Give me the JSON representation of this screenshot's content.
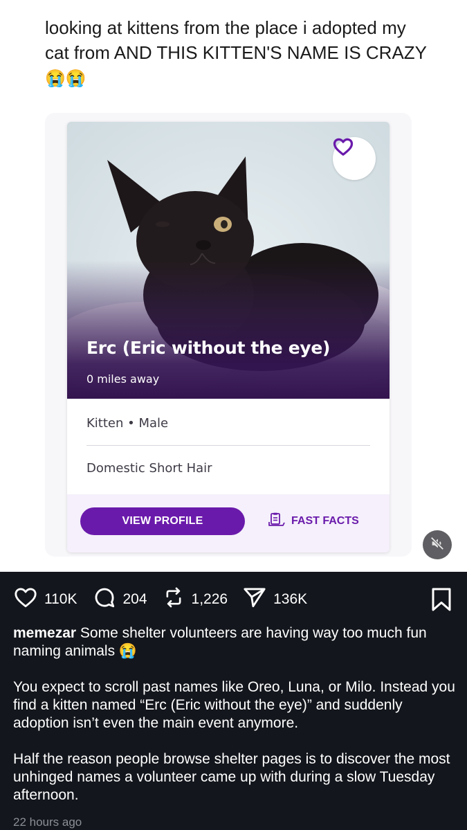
{
  "post": {
    "caption": "looking at kittens from the place i adopted my cat from AND THIS KITTEN'S NAME IS CRAZY",
    "caption_emoji": "😭😭"
  },
  "card": {
    "pet_name": "Erc (Eric without the eye)",
    "distance": "0 miles away",
    "age_sex": "Kitten • Male",
    "breed": "Domestic Short Hair",
    "view_profile_label": "VIEW PROFILE",
    "fast_facts_label": "FAST FACTS",
    "accent_color": "#6a1aab"
  },
  "stats": {
    "likes": "110K",
    "comments": "204",
    "reposts": "1,226",
    "shares": "136K"
  },
  "description": {
    "username": "memezar",
    "line1": "Some shelter volunteers are having way too much fun naming animals",
    "line1_emoji": "😭",
    "para2": "You expect to scroll past names like Oreo, Luna, or Milo. Instead you find a kitten named “Erc (Eric without the eye)” and suddenly adoption isn’t even the main event anymore.",
    "para3": "Half the reason people browse shelter pages is to discover the most unhinged names a volunteer came up with during a slow Tuesday afternoon.",
    "timestamp": "22 hours ago"
  }
}
